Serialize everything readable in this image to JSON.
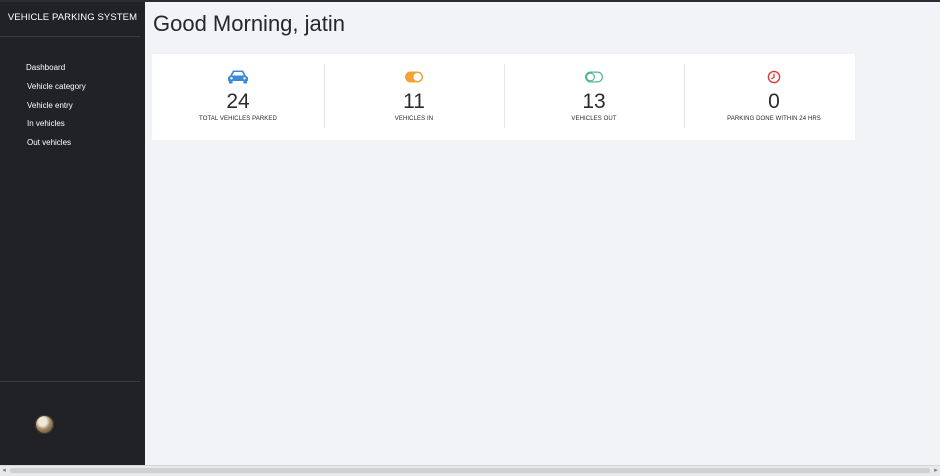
{
  "sidebar": {
    "brand": "VEHICLE PARKING SYSTEM",
    "items": [
      {
        "label": "Dashboard"
      },
      {
        "label": "Vehicle category"
      },
      {
        "label": "Vehicle entry"
      },
      {
        "label": "In vehicles"
      },
      {
        "label": "Out vehicles"
      }
    ]
  },
  "main": {
    "greeting": "Good Morning, jatin"
  },
  "stats": [
    {
      "value": "24",
      "label": "TOTAL VEHICLES PARKED",
      "icon": "car-icon",
      "color": "#3b8ad8"
    },
    {
      "value": "11",
      "label": "VEHICLES IN",
      "icon": "toggle-on-icon",
      "color": "#f3a233"
    },
    {
      "value": "13",
      "label": "VEHICLES OUT",
      "icon": "toggle-off-icon",
      "color": "#53b597"
    },
    {
      "value": "0",
      "label": "PARKING DONE WITHIN 24 HRS",
      "icon": "clock-icon",
      "color": "#e03a3a"
    }
  ]
}
